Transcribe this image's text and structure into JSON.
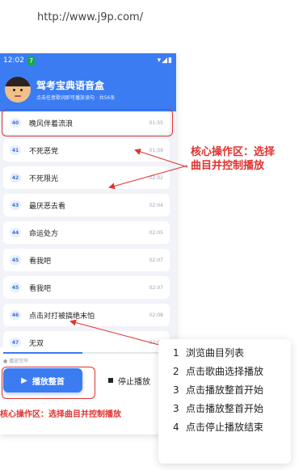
{
  "browser": {
    "url": "http://www.j9p.com/"
  },
  "status_bar": {
    "time": "12:02",
    "badge": "7",
    "icons": "▾◢▮"
  },
  "header": {
    "title": "驾考宝典语音盒",
    "subtitle": "点击任意歌词即可播放读句 · 共56条"
  },
  "tracks": [
    {
      "num": "40",
      "title": "晚风伴着流浪",
      "duration": "01:55"
    },
    {
      "num": "41",
      "title": "不死恶党",
      "duration": "01:59"
    },
    {
      "num": "42",
      "title": "不死限光",
      "duration": "02:02"
    },
    {
      "num": "43",
      "title": "最厌恶去看",
      "duration": "02:04"
    },
    {
      "num": "44",
      "title": "命运处方",
      "duration": "02:05"
    },
    {
      "num": "45",
      "title": "看我吧",
      "duration": "02:07"
    },
    {
      "num": "45",
      "title": "看我吧",
      "duration": "02:07"
    },
    {
      "num": "46",
      "title": "点击对打被搞绝末怕",
      "duration": "02:08"
    },
    {
      "num": "47",
      "title": "无双",
      "duration": "02:09"
    }
  ],
  "player": {
    "progress": 0.5,
    "status": "● 播放完毕",
    "play_all": "播放整首",
    "stop": "停止播放"
  },
  "annotations": {
    "callout": "核心操作区：选择曲目并控制播放",
    "caption": "核心操作区：选择曲目并控制播放"
  },
  "steps": [
    {
      "num": "1",
      "text": "浏览曲目列表"
    },
    {
      "num": "2",
      "text": "点击歌曲选择播放"
    },
    {
      "num": "3",
      "text": "点击播放整首开始"
    },
    {
      "num": "3",
      "text": "点击播放整首开始"
    },
    {
      "num": "4",
      "text": "点击停止播放结束"
    }
  ],
  "colors": {
    "accent": "#3b7cf2",
    "highlight": "#e0332f"
  }
}
